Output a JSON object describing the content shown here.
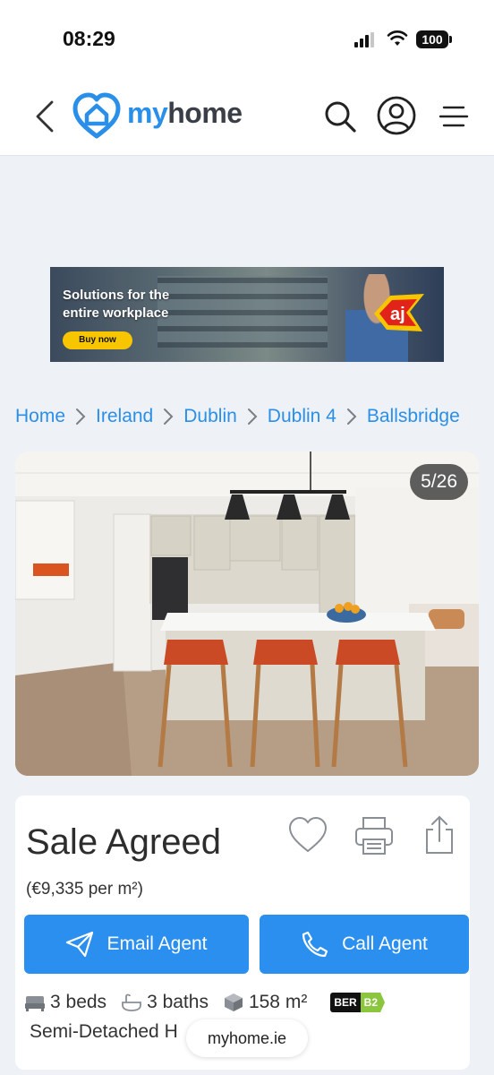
{
  "status_bar": {
    "time": "08:29",
    "battery": "100"
  },
  "header": {
    "logo_part1": "my",
    "logo_part2": "home",
    "icons": [
      "back-icon",
      "search-icon",
      "user-icon",
      "menu-icon"
    ]
  },
  "ad": {
    "headline": "Solutions for the entire workplace",
    "cta": "Buy now",
    "brand": "aj"
  },
  "breadcrumb": [
    "Home",
    "Ireland",
    "Dublin",
    "Dublin 4",
    "Ballsbridge"
  ],
  "gallery": {
    "counter": "5/26"
  },
  "listing": {
    "status": "Sale Agreed",
    "price_per_sqm": "(€9,335 per m²)",
    "email_agent": "Email Agent",
    "call_agent": "Call Agent",
    "beds": "3 beds",
    "baths": "3 baths",
    "size": "158 m²",
    "ber_label": "BER",
    "ber_rating": "B2",
    "property_type": "Semi-Detached H"
  },
  "browser": {
    "url": "myhome.ie"
  },
  "colors": {
    "accent": "#2a8fe8",
    "button": "#2b8ff0",
    "ber_b2": "#8cc63f"
  }
}
